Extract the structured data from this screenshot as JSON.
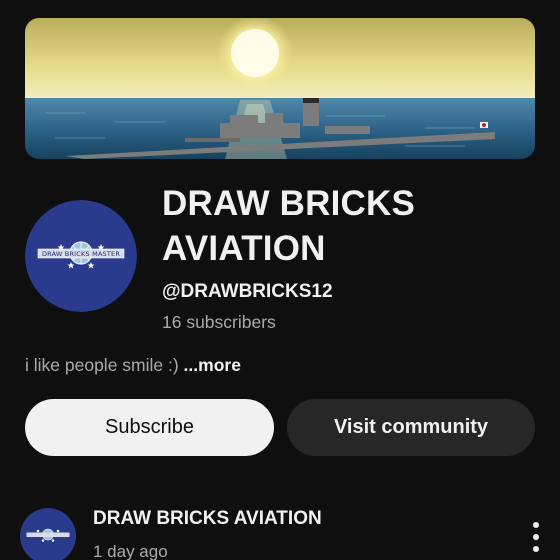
{
  "banner": {
    "image": "battleship-at-sunset"
  },
  "channel": {
    "name": "DRAW BRICKS AVIATION",
    "handle": "@DRAWBRICKS12",
    "subscribers": "16 subscribers",
    "avatar_text": "DRAW BRICKS MASTER",
    "description": "i like people smile :)",
    "more_label": "...more"
  },
  "actions": {
    "subscribe_label": "Subscribe",
    "community_label": "Visit community"
  },
  "post": {
    "author": "DRAW BRICKS AVIATION",
    "time": "1 day ago",
    "menu_icon": "more-vert-icon"
  },
  "colors": {
    "background": "#0f0f0f",
    "primary_text": "#f1f1f1",
    "secondary_text": "#aaaaaa",
    "avatar_blue": "#2a3a8c",
    "button_dark": "#272727"
  }
}
